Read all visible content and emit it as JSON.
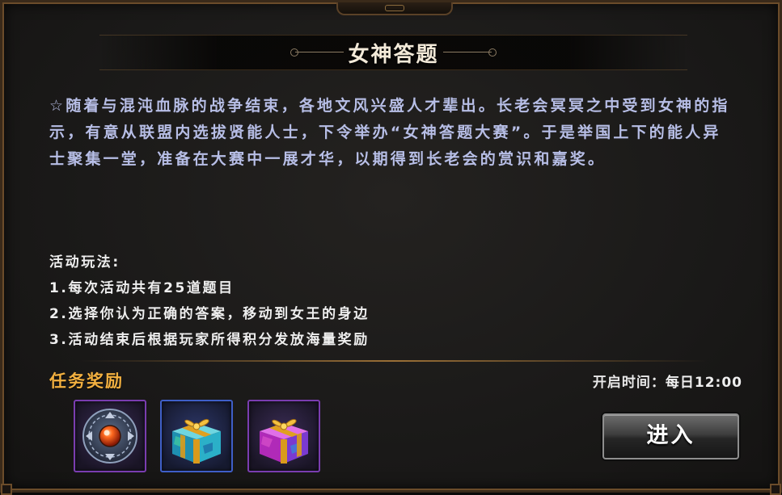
{
  "dialog": {
    "title": "女神答题"
  },
  "description": "☆随着与混沌血脉的战争结束，各地文风兴盛人才辈出。长老会冥冥之中受到女神的指示，有意从联盟内选拔贤能人士，下令举办“女神答题大赛”。于是举国上下的能人异士聚集一堂，准备在大赛中一展才华，以期得到长老会的赏识和嘉奖。",
  "rules": {
    "heading": "活动玩法:",
    "items": [
      "1.每次活动共有25道题目",
      "2.选择你认为正确的答案，移动到女王的身边",
      "3.活动结束后根据玩家所得积分发放海量奖励"
    ]
  },
  "rewards": {
    "title": "任务奖励",
    "items": [
      {
        "icon": "rune-amulet-icon",
        "frame_color": "#7a3db0"
      },
      {
        "icon": "blue-gift-box-icon",
        "frame_color": "#3f5fc8"
      },
      {
        "icon": "purple-gift-box-icon",
        "frame_color": "#7a3db0"
      }
    ]
  },
  "schedule": {
    "label": "开启时间：",
    "value": "每日12:00"
  },
  "enter_button": {
    "label": "进入"
  }
}
